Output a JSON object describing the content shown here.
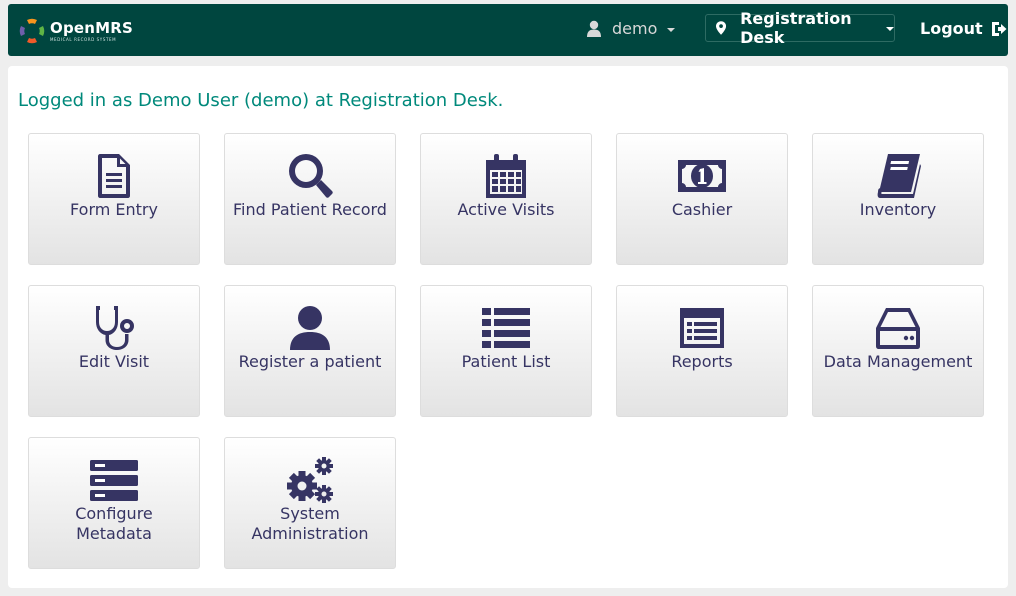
{
  "header": {
    "logo_name": "OpenMRS",
    "logo_sub": "MEDICAL RECORD SYSTEM",
    "user": "demo",
    "location": "Registration Desk",
    "logout": "Logout"
  },
  "welcome": "Logged in as Demo User (demo) at Registration Desk.",
  "apps": [
    {
      "label": "Form Entry",
      "icon": "file-text-icon"
    },
    {
      "label": "Find Patient Record",
      "icon": "search-icon"
    },
    {
      "label": "Active Visits",
      "icon": "calendar-icon"
    },
    {
      "label": "Cashier",
      "icon": "money-icon"
    },
    {
      "label": "Inventory",
      "icon": "book-icon"
    },
    {
      "label": "Edit Visit",
      "icon": "stethoscope-icon"
    },
    {
      "label": "Register a patient",
      "icon": "user-icon"
    },
    {
      "label": "Patient List",
      "icon": "list-icon"
    },
    {
      "label": "Reports",
      "icon": "report-icon"
    },
    {
      "label": "Data Management",
      "icon": "hdd-icon"
    },
    {
      "label": "Configure Metadata",
      "icon": "server-icon"
    },
    {
      "label": "System Administration",
      "icon": "gears-icon"
    }
  ],
  "colors": {
    "header_bg": "#00463f",
    "accent_text": "#00897b",
    "tile_text": "#363463"
  }
}
